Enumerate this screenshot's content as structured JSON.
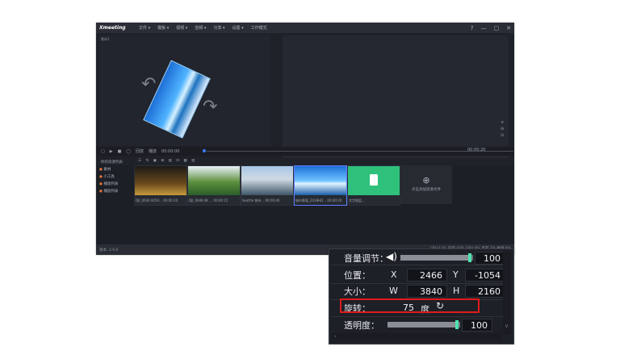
{
  "app": {
    "logo": "Xmeeting",
    "menu": [
      "文件 ▾",
      "模板 ▾",
      "视频 ▾",
      "音频 ▾",
      "分享 ▾",
      "设置 ▾",
      "工作模式"
    ],
    "window_controls": [
      "?",
      "—",
      "▢",
      "✕"
    ]
  },
  "preview": {
    "label": "素材1"
  },
  "transport": {
    "buttons": [
      "□",
      "▶",
      "■",
      "◯",
      "回放",
      "播放"
    ],
    "time_start": "00:00:00",
    "time_end": "00:00:20"
  },
  "library": {
    "title": "你的资源列表",
    "tools": "☰ ⇅ ▣ ⊞ ▤ ⊡ ▦ ▥",
    "sidebar": [
      "素材",
      "小工具",
      "播放列表",
      "播放列表"
    ],
    "thumbs": [
      {
        "caption": "DJI_0046 0050... 00:00:20"
      },
      {
        "caption": "DJI_0048 4K ... 00:00:15"
      },
      {
        "caption": "Seattle 城市... 00:00:40"
      },
      {
        "caption": "城市景观_2018HD... 00:00:20"
      },
      {
        "caption": "文字图层..."
      }
    ],
    "add_label": "点击添加资源文件"
  },
  "status": {
    "version": "版本: 2.9.0",
    "metrics": "CPU:11% 内存:47% GPU:4%  显存:7%  磁盘:8%"
  },
  "props": {
    "volume": {
      "label": "音量调节：",
      "value": "100",
      "level": 0.95
    },
    "position": {
      "label": "位置：",
      "x_label": "X",
      "x": "2466",
      "y_label": "Y",
      "y": "-1054"
    },
    "size": {
      "label": "大小：",
      "w_label": "W",
      "w": "3840",
      "h_label": "H",
      "h": "2160"
    },
    "rotation": {
      "label": "旋转：",
      "value": "75",
      "unit": "度"
    },
    "opacity": {
      "label": "透明度：",
      "value": "100",
      "level": 0.95
    }
  },
  "colors": {
    "accent": "#4fe3b0",
    "highlight": "#e01b1b",
    "panel": "#1d2027"
  }
}
